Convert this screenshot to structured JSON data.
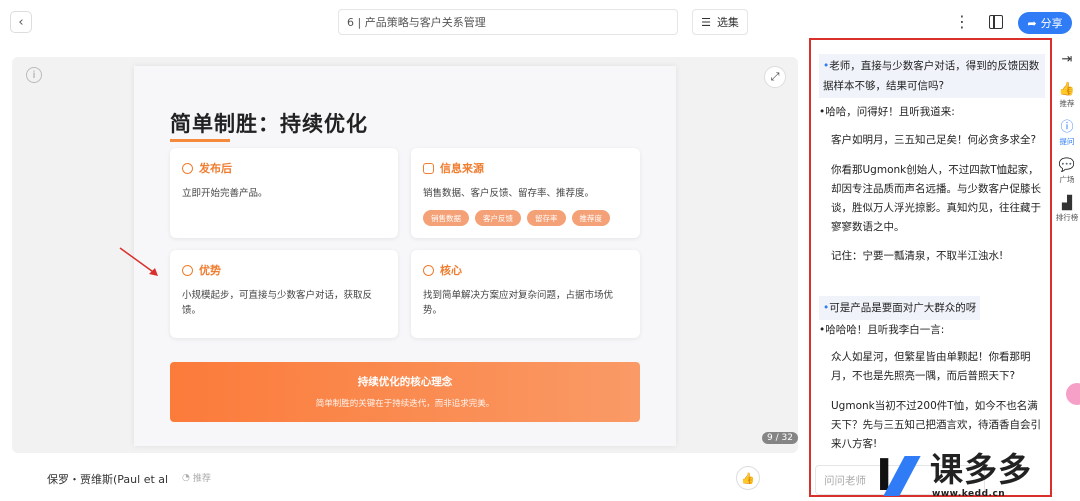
{
  "header": {
    "title": "6 | 产品策略与客户关系管理",
    "episodes_label": "选集",
    "share_label": "分享"
  },
  "slide": {
    "title": "简单制胜：持续优化",
    "cards": [
      {
        "heading": "发布后",
        "body": "立即开始完善产品。"
      },
      {
        "heading": "信息来源",
        "body": "销售数据、客户反馈、留存率、推荐度。",
        "tags": [
          "销售数据",
          "客户反馈",
          "留存率",
          "推荐度"
        ]
      },
      {
        "heading": "优势",
        "body": "小规模起步，可直接与少数客户对话，获取反馈。"
      },
      {
        "heading": "核心",
        "body": "找到简单解决方案应对复杂问题，占据市场优势。"
      }
    ],
    "banner_title": "持续优化的核心理念",
    "banner_subtitle": "简单制胜的关键在于持续迭代，而非追求完美。",
    "page_indicator": "9 / 32"
  },
  "footer": {
    "author": "保罗・贾维斯(Paul et al",
    "recommend_label": "推荐"
  },
  "chat": {
    "q1": "老师，直接与少数客户对话，得到的反馈因数据样本不够，结果可信吗?",
    "a1_label": "哈哈，问得好！且听我道来:",
    "a1_p1": "客户如明月，三五知己足矣！何必贪多求全?",
    "a1_p2": "你看那Ugmonk创始人，不过四款T恤起家，却因专注品质而声名远播。与少数客户促膝长谈，胜似万人浮光掠影。真知灼见，往往藏于寥寥数语之中。",
    "a1_p3": "记住：宁要一瓢清泉，不取半江浊水!",
    "q2": "可是产品是要面对广大群众的呀",
    "a2_label": "哈哈哈！且听我李白一言:",
    "a2_p1": "众人如星河，但繁星皆由单颗起！你看那明月，不也是先照亮一隅，而后普照天下?",
    "a2_p2": "Ugmonk当初不过200件T恤，如今不也名满天下？先与三五知己把酒言欢，待酒香自会引来八方客!",
    "input_placeholder": "问问老师"
  },
  "rail": {
    "items": [
      {
        "label": "",
        "icon": "collapse-icon"
      },
      {
        "label": "推荐",
        "icon": "thumb-up-icon"
      },
      {
        "label": "提问",
        "icon": "question-icon"
      },
      {
        "label": "广场",
        "icon": "chat-bubble-icon"
      },
      {
        "label": "排行榜",
        "icon": "leaderboard-icon"
      }
    ]
  },
  "watermark": {
    "text": "课多多",
    "url": "www.kedd.cn"
  },
  "colors": {
    "accent": "#2f7cf6",
    "orange": "#f07d30",
    "highlight_border": "#d9302b"
  }
}
